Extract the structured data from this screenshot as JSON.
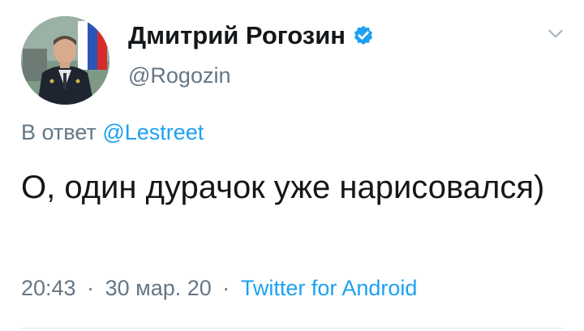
{
  "author": {
    "display_name": "Дмитрий Рогозин",
    "handle": "@Rogozin",
    "verified": true
  },
  "reply": {
    "prefix": "В ответ",
    "mention": "@Lestreet"
  },
  "tweet": {
    "text": "О, один дурачок уже нарисовался)"
  },
  "meta": {
    "time": "20:43",
    "separator": "·",
    "date": "30 мар. 20",
    "source": "Twitter for Android"
  },
  "icons": {
    "verified": "verified-badge-icon",
    "menu": "chevron-down-icon"
  },
  "colors": {
    "link": "#1da1f2",
    "secondary_text": "#657786",
    "primary_text": "#14171a"
  }
}
